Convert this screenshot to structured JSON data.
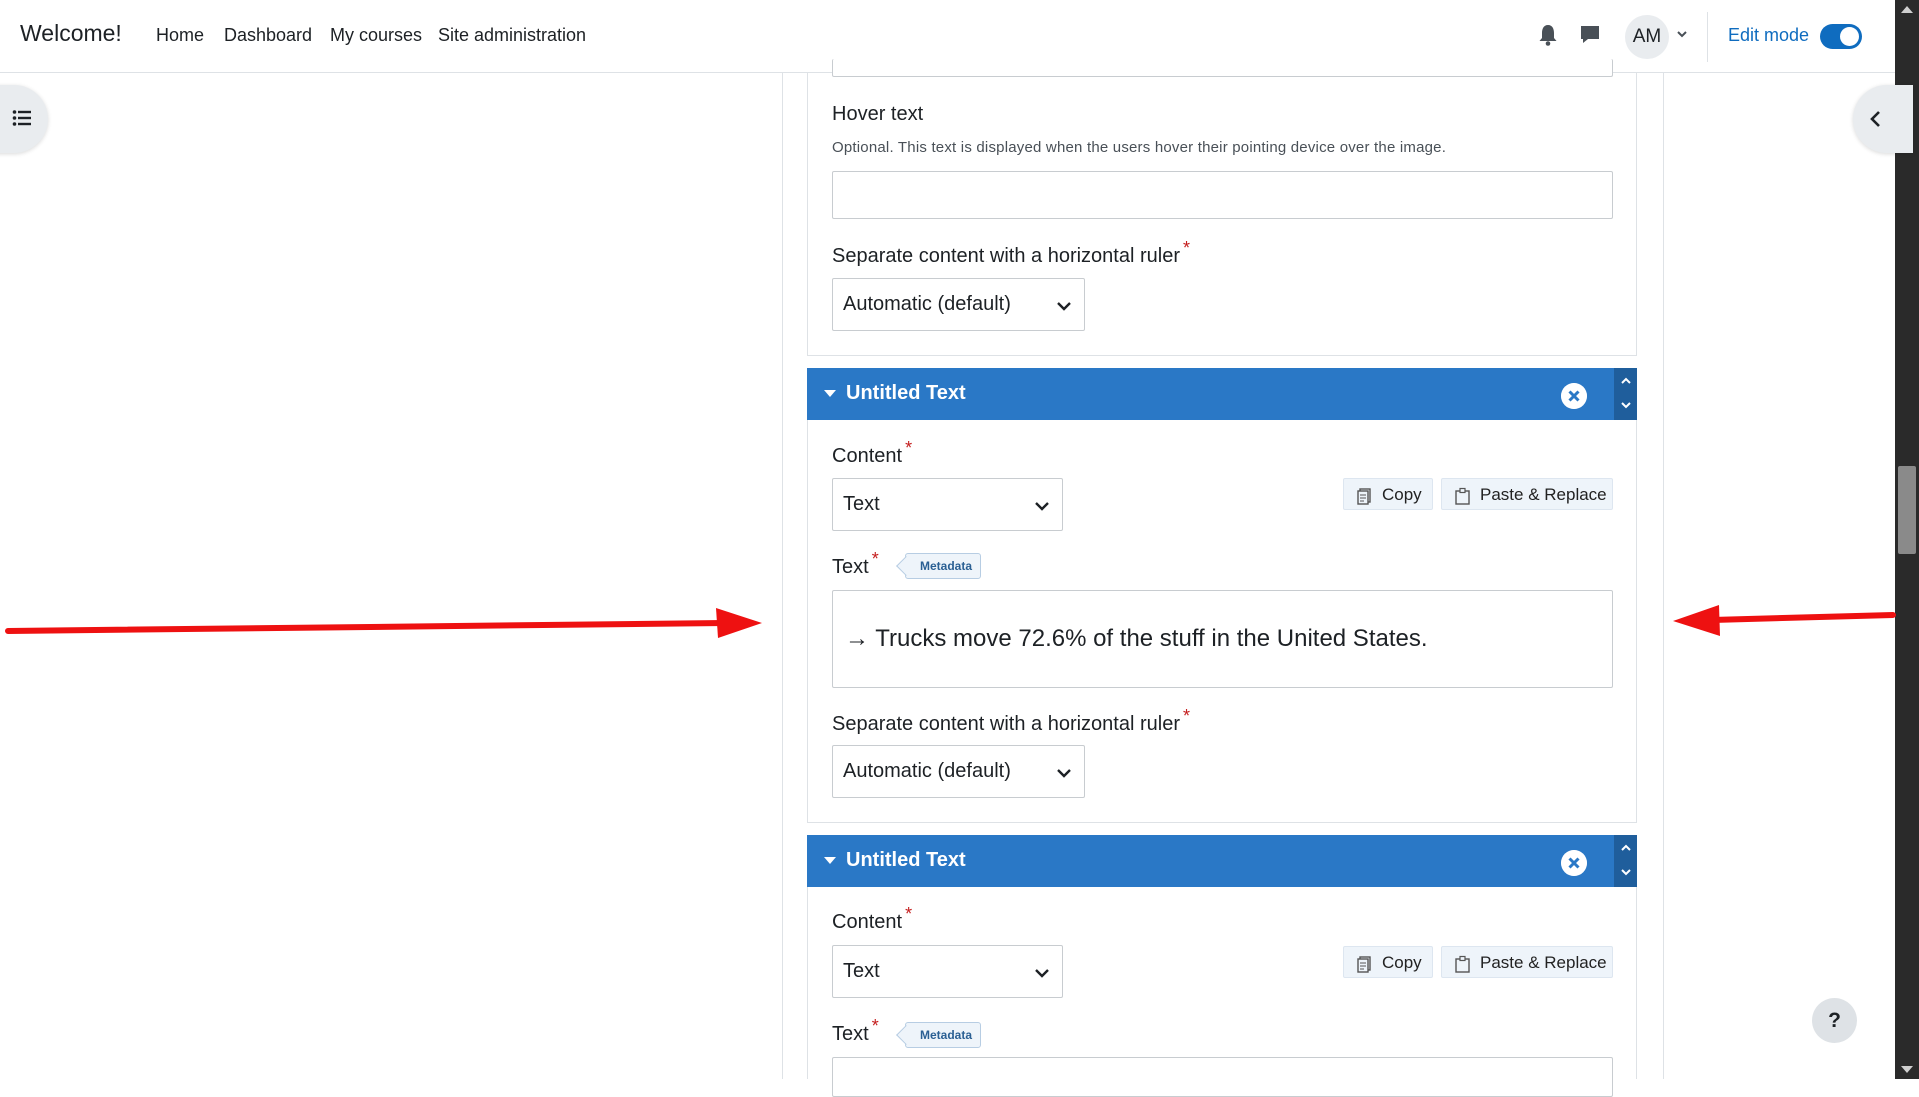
{
  "navbar": {
    "brand": "Welcome!",
    "links": [
      "Home",
      "Dashboard",
      "My courses",
      "Site administration"
    ],
    "avatar_initials": "AM",
    "edit_mode_label": "Edit mode",
    "edit_mode_on": true
  },
  "form": {
    "hover_text": {
      "label": "Hover text",
      "description": "Optional. This text is displayed when the users hover their pointing device over the image.",
      "value": ""
    },
    "separator_1": {
      "label": "Separate content with a horizontal ruler",
      "required_mark": "*",
      "value": "Automatic (default)"
    },
    "panels": [
      {
        "title": "Untitled Text",
        "content_label": "Content",
        "content_value": "Text",
        "copy_label": "Copy",
        "paste_label": "Paste & Replace",
        "text_label": "Text",
        "metadata_label": "Metadata",
        "text_value": "→ Trucks move 72.6% of the stuff in the United States.",
        "separator_label": "Separate content with a horizontal ruler",
        "separator_value": "Automatic (default)"
      },
      {
        "title": "Untitled Text",
        "content_label": "Content",
        "content_value": "Text",
        "copy_label": "Copy",
        "paste_label": "Paste & Replace",
        "text_label": "Text",
        "metadata_label": "Metadata",
        "text_value": ""
      }
    ]
  },
  "help_button": "?",
  "colors": {
    "panel_header": "#2a78c6",
    "accent": "#0f6cbf",
    "required": "#c41d1d",
    "annotation_arrow": "#ee1111"
  }
}
